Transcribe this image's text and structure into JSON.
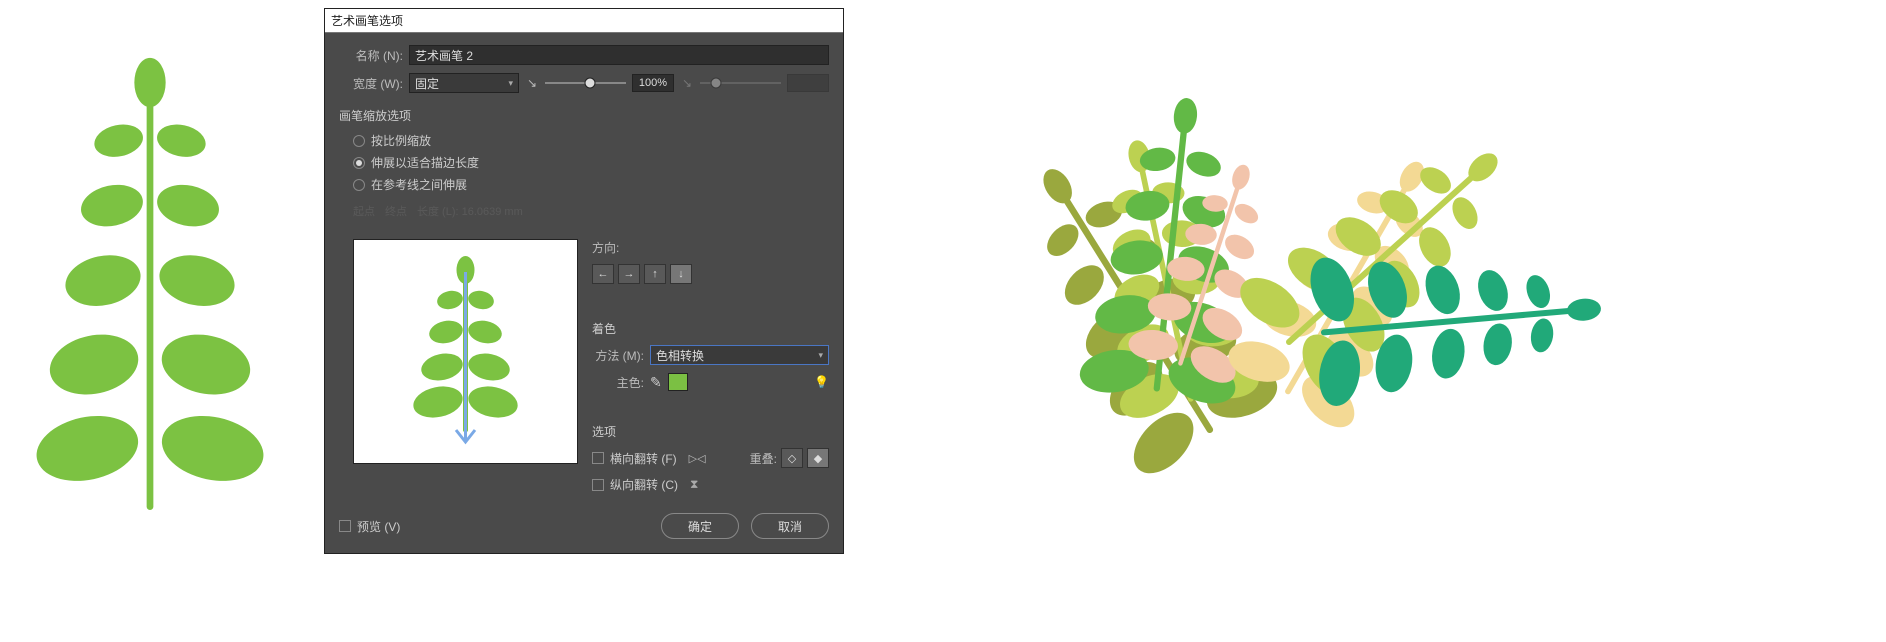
{
  "dialog": {
    "title": "艺术画笔选项",
    "name_label": "名称 (N):",
    "name_value": "艺术画笔 2",
    "width_label": "宽度 (W):",
    "width_mode": "固定",
    "width_value": "100%",
    "scaling_section": "画笔缩放选项",
    "scaling_options": [
      {
        "label": "按比例缩放",
        "checked": false
      },
      {
        "label": "伸展以适合描边长度",
        "checked": true
      },
      {
        "label": "在参考线之间伸展",
        "checked": false
      }
    ],
    "disabled_line_a": "起点",
    "disabled_line_b": "终点",
    "disabled_line_c": "长度 (L): 16.0639 mm",
    "direction_label": "方向:",
    "colorization_section": "着色",
    "method_label": "方法 (M):",
    "method_value": "色相转换",
    "keycolor_label": "主色:",
    "keycolor_hex": "#7bc043",
    "options_section": "选项",
    "flip_x_label": "横向翻转 (F)",
    "flip_y_label": "纵向翻转 (C)",
    "overlap_label": "重叠:",
    "preview_label": "预览 (V)",
    "ok_label": "确定",
    "cancel_label": "取消"
  },
  "left_plant_color": "#7cc242",
  "arrangement_palette": {
    "bright_green": "#62b946",
    "olive": "#9aa83e",
    "lime": "#bcd151",
    "pink": "#f2c4ab",
    "cream": "#f3d994",
    "teal": "#21a979"
  }
}
